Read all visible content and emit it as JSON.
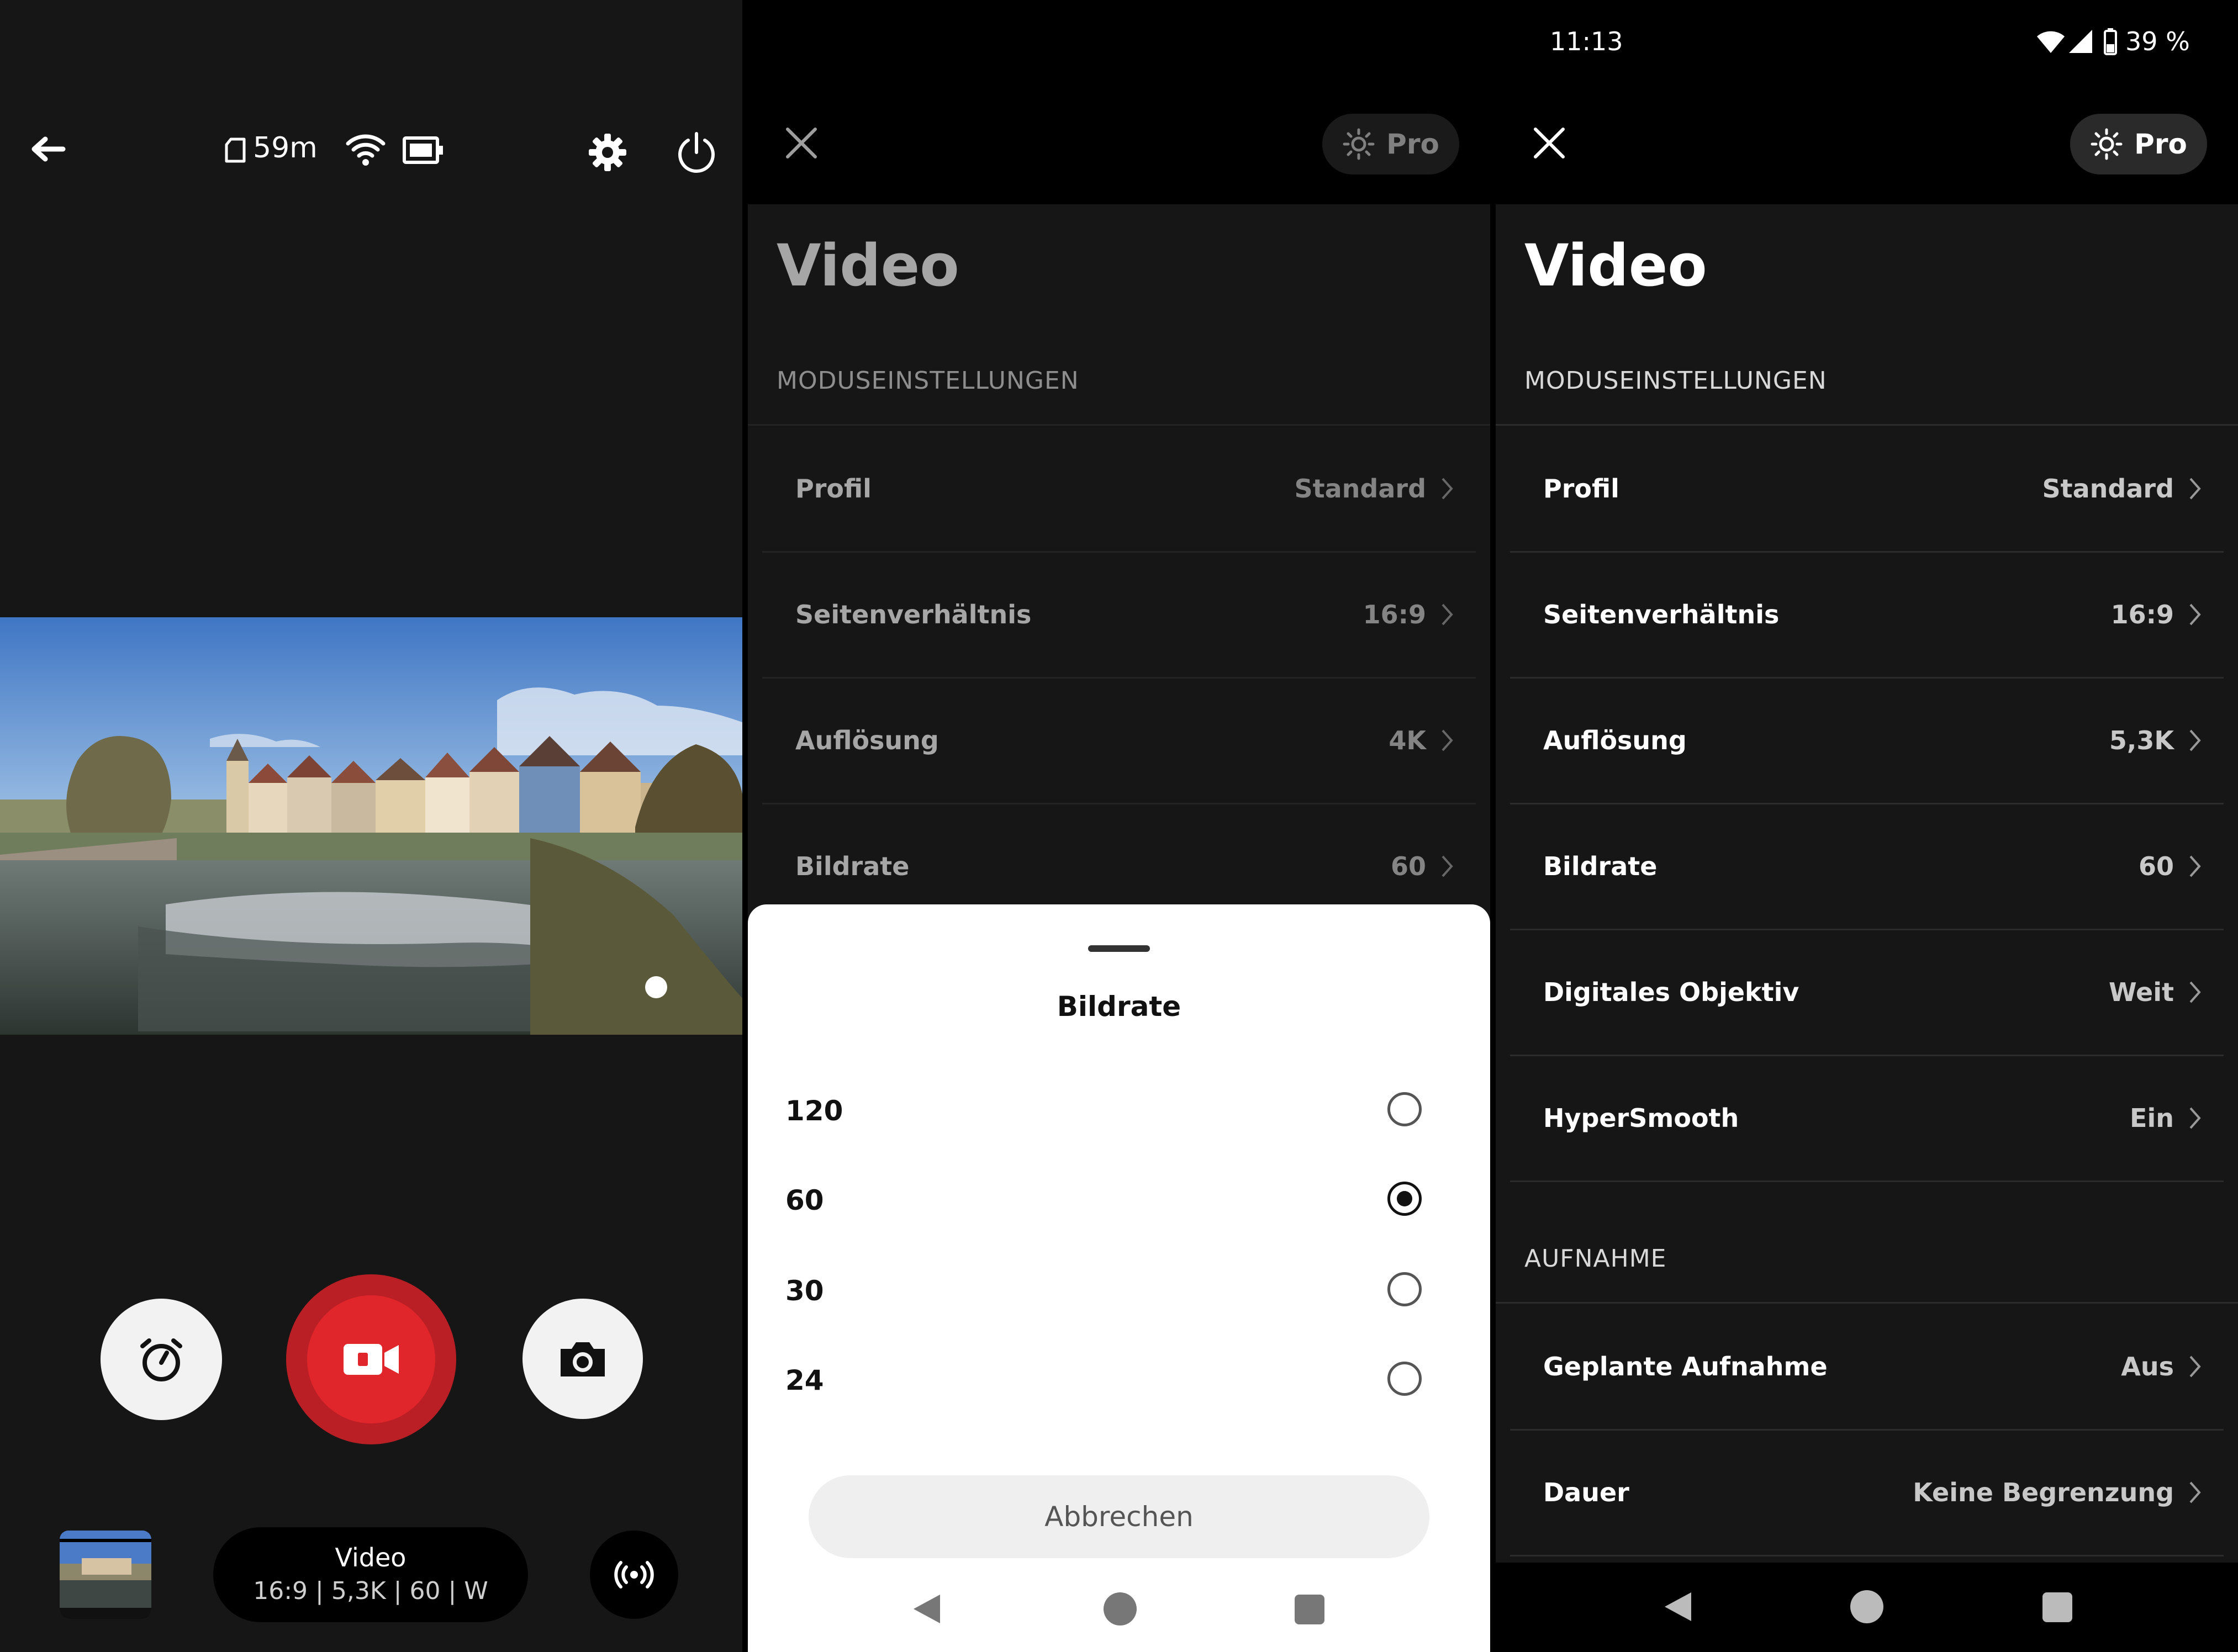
{
  "camera": {
    "storage_left": "59m",
    "mode_title": "Video",
    "mode_details": "16:9 | 5,3K | 60 | W"
  },
  "colors": {
    "record_red": "#e0262b",
    "record_ring": "#b91f24"
  },
  "icons": [
    "back-arrow-icon",
    "sd-card-icon",
    "wifi-icon",
    "battery-icon",
    "gear-icon",
    "power-icon",
    "timer-icon",
    "video-camera-icon",
    "photo-camera-icon",
    "live-broadcast-icon",
    "close-icon",
    "pro-settings-icon",
    "chevron-right-icon"
  ],
  "settings_mid": {
    "title": "Video",
    "pro_label": "Pro",
    "section_mode": "MODUSEINSTELLUNGEN",
    "rows": [
      {
        "label": "Profil",
        "value": "Standard"
      },
      {
        "label": "Seitenverhältnis",
        "value": "16:9"
      },
      {
        "label": "Auflösung",
        "value": "4K"
      },
      {
        "label": "Bildrate",
        "value": "60"
      }
    ]
  },
  "sheet": {
    "title": "Bildrate",
    "options": [
      "120",
      "60",
      "30",
      "24"
    ],
    "selected": "60",
    "cancel_label": "Abbrechen"
  },
  "settings_right": {
    "status_time": "11:13",
    "status_battery": "39 %",
    "title": "Video",
    "pro_label": "Pro",
    "section_mode": "MODUSEINSTELLUNGEN",
    "rows": [
      {
        "label": "Profil",
        "value": "Standard"
      },
      {
        "label": "Seitenverhältnis",
        "value": "16:9"
      },
      {
        "label": "Auflösung",
        "value": "5,3K"
      },
      {
        "label": "Bildrate",
        "value": "60"
      },
      {
        "label": "Digitales Objektiv",
        "value": "Weit"
      },
      {
        "label": "HyperSmooth",
        "value": "Ein"
      }
    ],
    "section_record": "AUFNAHME",
    "rows2": [
      {
        "label": "Geplante Aufnahme",
        "value": "Aus"
      },
      {
        "label": "Dauer",
        "value": "Keine Begrenzung"
      }
    ]
  }
}
